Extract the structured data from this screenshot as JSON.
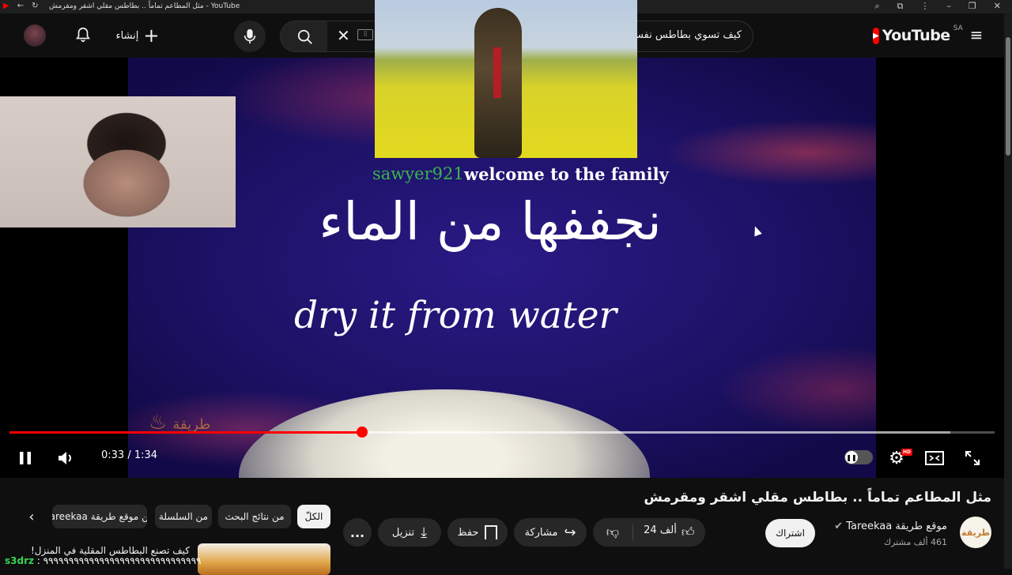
{
  "window": {
    "title": "مثل المطاعم تماماً .. بطاطس مقلي اشقر ومقرمش - YouTube",
    "favicon": "youtube-icon"
  },
  "header": {
    "logo_text": "YouTube",
    "country_code": "SA",
    "search_value": "كيف تسوي بطاطس نفس",
    "create_label": "إنشاء",
    "icons": [
      "menu-icon",
      "search-icon",
      "clear-icon",
      "keyboard-icon",
      "mic-icon",
      "plus-icon",
      "bell-icon"
    ]
  },
  "overlay": {
    "chat_user": "sawyer921",
    "chat_message": "welcome to the family"
  },
  "video": {
    "caption_arabic": "نجففها من الماء",
    "caption_english": "dry it from water",
    "watermark": "طريقة",
    "current_time": "0:33",
    "total_time": "1:34",
    "time_separator": " / ",
    "progress_fraction": 0.358,
    "buffered_fraction": 0.955,
    "hd_badge": "HD"
  },
  "info": {
    "title": "مثل المطاعم تماماً .. بطاطس مقلي اشقر ومقرمش",
    "channel_name": "موقع طريقة Tareekaa",
    "channel_logo_text": "طريقة",
    "subscribers": "461 ألف مشترك",
    "subscribe_label": "اشتراك",
    "like_count": "24 ألف",
    "share_label": "مشاركة",
    "save_label": "حفظ",
    "download_label": "تنزيل",
    "more_label": "..."
  },
  "chips": [
    "الكلّ",
    "من نتائج البحث",
    "من السلسلة",
    "من موقع طريقة Tareekaa"
  ],
  "recommendation": {
    "title": "كيف تصنع البطاطس المقلية في المنزل!"
  },
  "chat_bottom": {
    "user": "s3drz",
    "text": " : ٩٩٩٩٩٩٩٩٩٩٩٩٩٩٩٩٩٩٩٩٩٩٩٩٩٩٩٩٩٩٩"
  },
  "colors": {
    "accent": "#ff0000",
    "background": "#0f0f0f",
    "chip": "#272727",
    "chat_user": "#39b54a"
  }
}
